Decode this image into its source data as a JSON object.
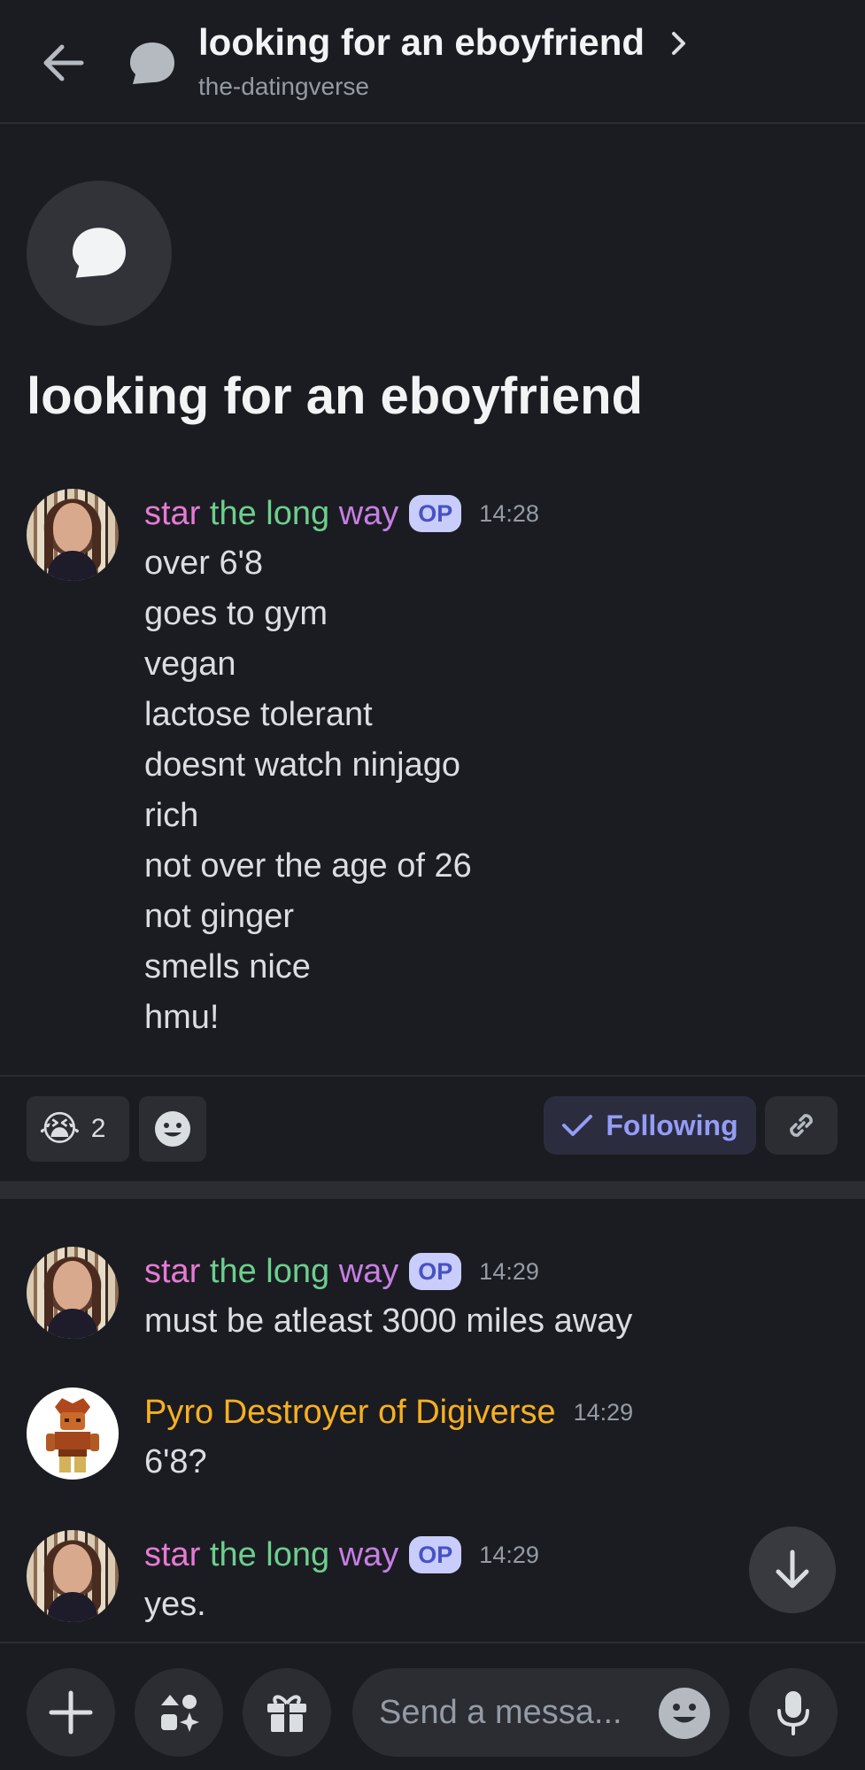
{
  "header": {
    "title": "looking for an eboyfriend",
    "channel": "the-datingverse"
  },
  "thread": {
    "title": "looking for an eboyfriend"
  },
  "messages": [
    {
      "author_parts": [
        "star ",
        "the long",
        " way"
      ],
      "op_badge": "OP",
      "time": "14:28",
      "lines": [
        "over 6'8",
        "goes to gym",
        "vegan",
        "lactose tolerant",
        "doesnt watch ninjago",
        "rich",
        "not over the age of 26",
        "not ginger",
        "smells nice",
        "hmu!"
      ]
    },
    {
      "author_parts": [
        "star ",
        "the long",
        " way"
      ],
      "op_badge": "OP",
      "time": "14:29",
      "lines": [
        "must be atleast 3000 miles away"
      ]
    },
    {
      "author": "Pyro Destroyer of Digiverse",
      "time": "14:29",
      "lines": [
        "6'8?"
      ]
    },
    {
      "author_parts": [
        "star ",
        "the long",
        " way"
      ],
      "op_badge": "OP",
      "time": "14:29",
      "lines": [
        "yes."
      ]
    }
  ],
  "reactions": {
    "emoji": "😭",
    "count": "2",
    "following_label": "Following"
  },
  "composer": {
    "placeholder": "Send a messa..."
  },
  "icons": [
    "back-arrow-icon",
    "thread-icon",
    "chevron-right-icon",
    "add-reaction-icon",
    "check-icon",
    "link-icon",
    "arrow-down-icon",
    "plus-icon",
    "apps-icon",
    "gift-icon",
    "emoji-icon",
    "microphone-icon"
  ],
  "colors": {
    "background": "#1b1c21",
    "accent": "#949cf7",
    "op_badge_bg": "#c9cdfb",
    "name_pink": "#e77ad6",
    "name_green": "#6ccf8e",
    "name_purple": "#c77ee5",
    "name_gold": "#f7b021"
  }
}
